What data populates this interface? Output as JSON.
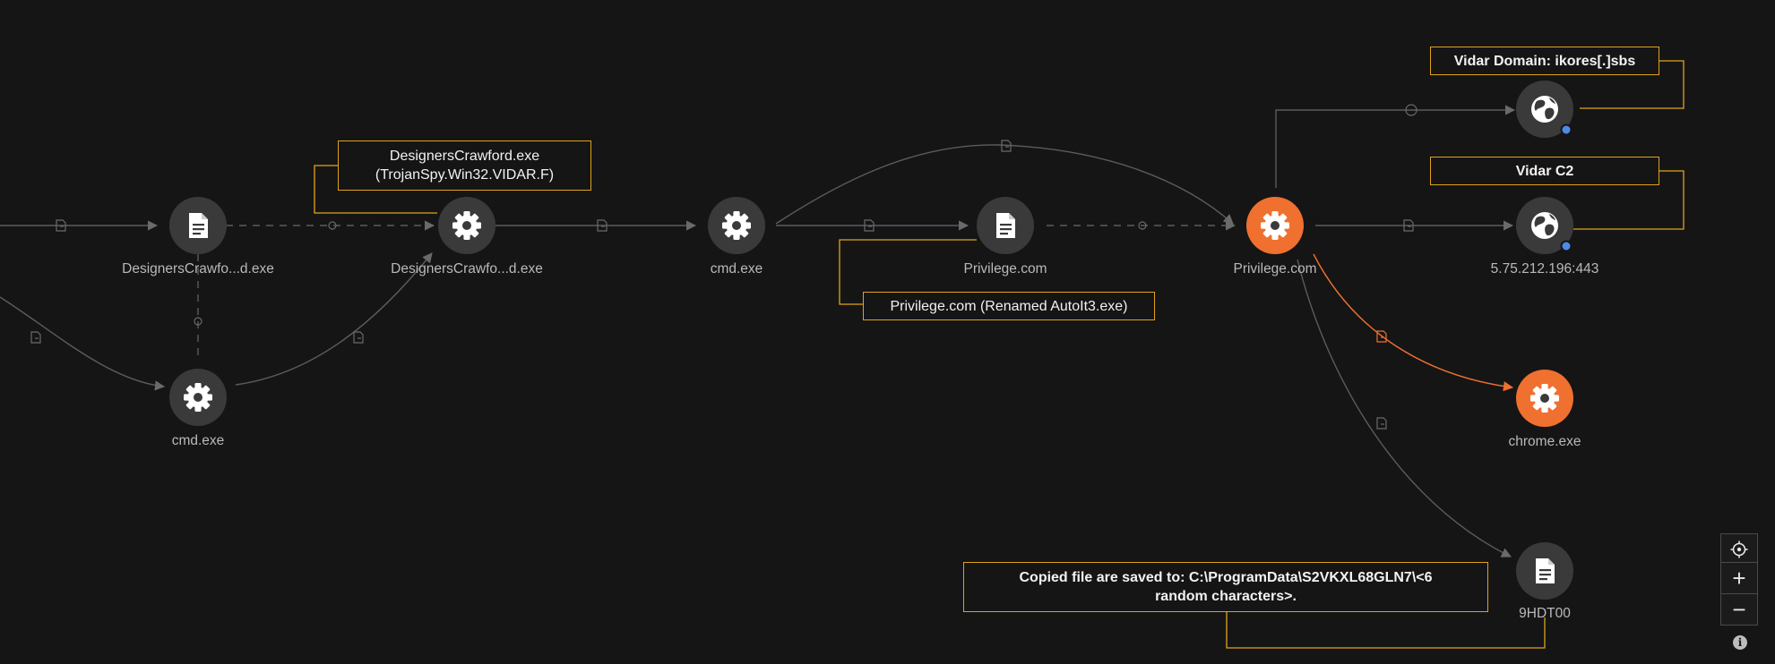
{
  "nodes": {
    "n1": {
      "label": "DesignersCrawfo...d.exe",
      "kind": "file",
      "color": "#3a3a3a"
    },
    "n2": {
      "label": "DesignersCrawfo...d.exe",
      "kind": "process",
      "color": "#3a3a3a"
    },
    "n3": {
      "label": "cmd.exe",
      "kind": "process",
      "color": "#3a3a3a"
    },
    "n4": {
      "label": "cmd.exe",
      "kind": "process",
      "color": "#3a3a3a"
    },
    "n5": {
      "label": "Privilege.com",
      "kind": "file",
      "color": "#3a3a3a"
    },
    "n6": {
      "label": "Privilege.com",
      "kind": "process",
      "color": "#f07030"
    },
    "n7": {
      "label": "",
      "kind": "domain",
      "color": "#3a3a3a"
    },
    "n8": {
      "label": "5.75.212.196:443",
      "kind": "network",
      "color": "#3a3a3a"
    },
    "n9": {
      "label": "chrome.exe",
      "kind": "process",
      "color": "#f07030"
    },
    "n10": {
      "label": "9HDT00",
      "kind": "file",
      "color": "#3a3a3a"
    }
  },
  "notes": {
    "designers": {
      "line1": "DesignersCrawford.exe",
      "line2": "(TrojanSpy.Win32.VIDAR.F)"
    },
    "privilege": {
      "text": "Privilege.com (Renamed AutoIt3.exe)"
    },
    "vidar_domain": {
      "text": "Vidar Domain: ikores[.]sbs"
    },
    "vidar_c2": {
      "text": "Vidar C2"
    },
    "copied": {
      "line1": "Copied file are saved to: C:\\ProgramData\\S2VKXL68GLN7\\<6",
      "line2": "random characters>."
    }
  },
  "controls": {
    "zoom_in": "+",
    "zoom_out": "−",
    "info": "i"
  },
  "colors": {
    "background": "#151515",
    "node_default": "#3a3a3a",
    "node_highlight": "#f07030",
    "edge": "#5c5c5c",
    "edge_highlight": "#f07030",
    "note_border": "#e0a31a",
    "network_dot": "#4d8be8"
  }
}
